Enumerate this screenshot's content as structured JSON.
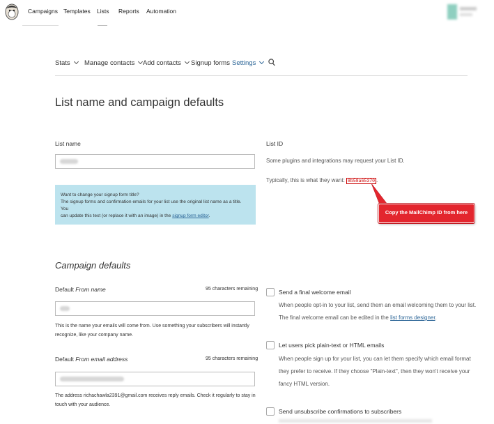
{
  "topnav": {
    "items": [
      "Campaigns",
      "Templates",
      "Lists",
      "Reports",
      "Automation"
    ]
  },
  "subnav": {
    "stats": "Stats",
    "manage_contacts": "Manage contacts",
    "add_contacts": "Add contacts",
    "signup_forms": "Signup forms",
    "settings": "Settings"
  },
  "page_title": "List name and campaign defaults",
  "list_name": {
    "label": "List name"
  },
  "infobox": {
    "title": "Want to change your signup form title?",
    "body_line1": "The signup forms and confirmation emails for your list use the original list name as a title. You",
    "body_line2_prefix": "can update this text (or replace it with an image) in the",
    "link": "signup form editor",
    "body_line2_suffix": "."
  },
  "list_id": {
    "label": "List ID",
    "description": "Some plugins and integrations may request your List ID.",
    "typical_prefix": "Typically, this is what they want:",
    "value": "8b58a65370",
    "value_suffix": "."
  },
  "callout": {
    "text": "Copy the MailChimp ID from here",
    "color": "#e3262e"
  },
  "campaign_defaults": {
    "heading": "Campaign defaults",
    "from_name": {
      "label_prefix": "Default ",
      "label_em": "From name",
      "remaining": "95 characters remaining",
      "help_line1": "This is the name your emails will come from. Use something your subscribers will instantly",
      "help_line2": "recognize, like your company name."
    },
    "from_email": {
      "label_prefix": "Default ",
      "label_em": "From email address",
      "remaining": "95 characters remaining",
      "help_line1": "The address richachawla2391@gmail.com receives reply emails. Check it regularly to stay in",
      "help_line2": "touch with your audience."
    }
  },
  "options": {
    "welcome": {
      "title": "Send a final welcome email",
      "desc_line1": "When people opt-in to your list, send them an email welcoming them to your list.",
      "desc_line2_prefix": "The final welcome email can be edited in the",
      "link": "list forms designer",
      "desc_line2_suffix": "."
    },
    "plaintext": {
      "title": "Let users pick plain-text or HTML emails",
      "desc_line1": "When people sign up for your list, you can let them specify which email format",
      "desc_line2": "they prefer to receive. If they choose \"Plain-text\", then they won't receive your",
      "desc_line3": "fancy HTML version."
    },
    "unsubscribe": {
      "title": "Send unsubscribe confirmations to subscribers"
    }
  }
}
